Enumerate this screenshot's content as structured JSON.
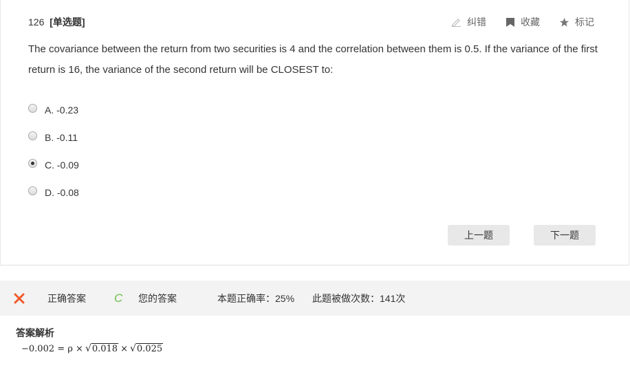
{
  "question": {
    "number": "126",
    "type": "[单选题]",
    "text": "The covariance between the return from two securities is 4 and the correlation between them is 0.5. If the variance of the first return is 16, the variance of the second return will be CLOSEST to:"
  },
  "tools": {
    "correct_label": "纠错",
    "favorite_label": "收藏",
    "mark_label": "标记"
  },
  "options": [
    {
      "label": "A. -0.23",
      "selected": false
    },
    {
      "label": "B. -0.11",
      "selected": false
    },
    {
      "label": "C. -0.09",
      "selected": true
    },
    {
      "label": "D. -0.08",
      "selected": false
    }
  ],
  "nav": {
    "prev_label": "上一题",
    "next_label": "下一题"
  },
  "result": {
    "correct_answer_label": "正确答案",
    "correct_answer_value": "C",
    "your_answer_label": "您的答案",
    "accuracy_text": "本题正确率：25%",
    "attempts_text": "此题被做次数：141次"
  },
  "analysis": {
    "title": "答案解析",
    "formula_lhs": "−0.002 = ρ ×",
    "sqrt1": "0.018",
    "times": "×",
    "sqrt2": "0.025"
  },
  "colors": {
    "wrong_x": "#f05a28",
    "your_answer_mark": "#6cc04a",
    "button_bg": "#e8e8e8",
    "stats_bg": "#f3f3f3"
  },
  "icons": {
    "correct": "pencil-icon",
    "favorite": "bookmark-icon",
    "mark": "star-icon",
    "wrong": "x-mark-icon"
  }
}
